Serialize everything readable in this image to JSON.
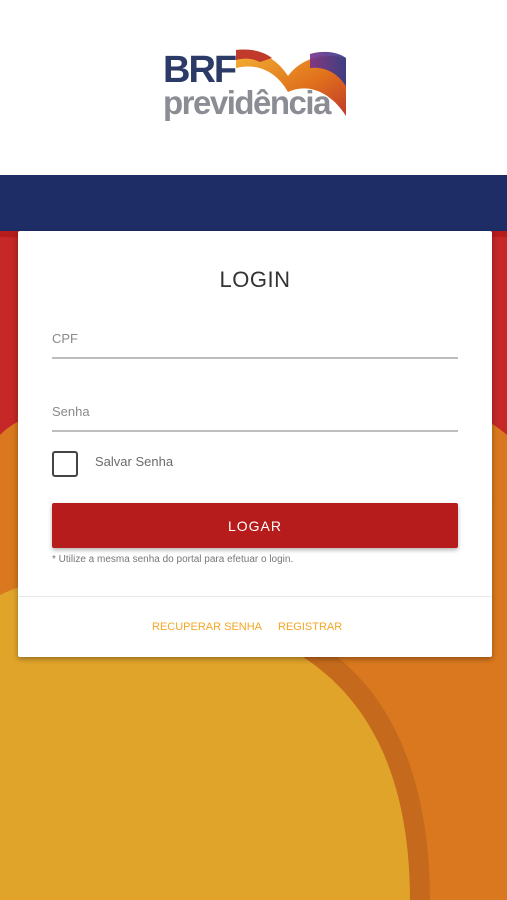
{
  "brand": {
    "name_top": "BRF",
    "name_bottom": "previdência",
    "colors": {
      "navy": "#1f2d66",
      "red": "#b71c1c",
      "orange": "#d9781e",
      "yellow": "#e0a42a",
      "gray": "#8a8d93"
    }
  },
  "login": {
    "title": "LOGIN",
    "cpf_placeholder": "CPF",
    "senha_placeholder": "Senha",
    "remember_label": "Salvar Senha",
    "remember_checked": false,
    "submit_label": "LOGAR",
    "hint": "* Utilize a mesma senha do portal para efetuar o login."
  },
  "links": {
    "recover": "RECUPERAR SENHA",
    "register": "REGISTRAR"
  }
}
